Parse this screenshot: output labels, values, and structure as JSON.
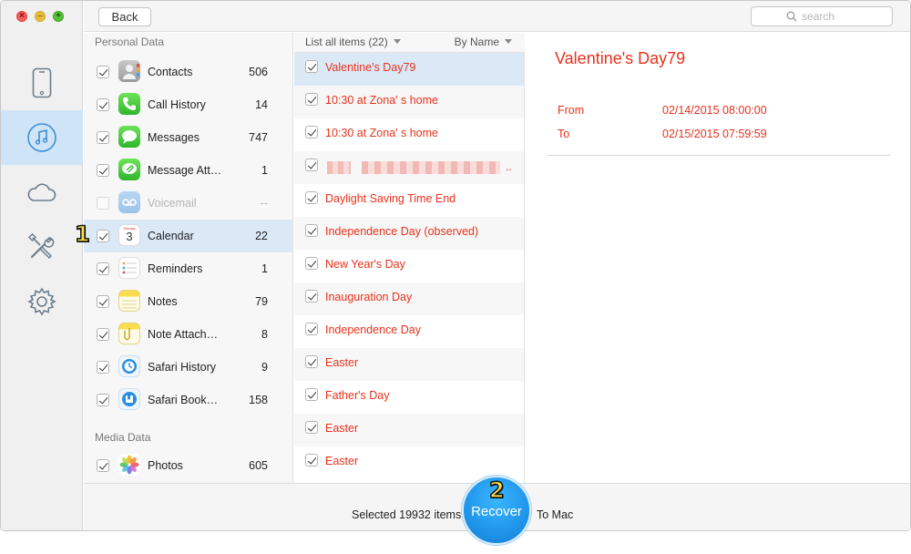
{
  "toolbar": {
    "back_label": "Back",
    "search_placeholder": "search"
  },
  "categories": {
    "personal_header": "Personal Data",
    "media_header": "Media Data",
    "items": [
      {
        "name": "Contacts",
        "count": "506",
        "checked": true,
        "icon": "contacts-icon"
      },
      {
        "name": "Call History",
        "count": "14",
        "checked": true,
        "icon": "phone-icon"
      },
      {
        "name": "Messages",
        "count": "747",
        "checked": true,
        "icon": "messages-icon"
      },
      {
        "name": "Message Att…",
        "count": "1",
        "checked": true,
        "icon": "message-attachment-icon"
      },
      {
        "name": "Voicemail",
        "count": "--",
        "checked": false,
        "icon": "voicemail-icon"
      },
      {
        "name": "Calendar",
        "count": "22",
        "checked": true,
        "icon": "calendar-icon"
      },
      {
        "name": "Reminders",
        "count": "1",
        "checked": true,
        "icon": "reminders-icon"
      },
      {
        "name": "Notes",
        "count": "79",
        "checked": true,
        "icon": "notes-icon"
      },
      {
        "name": "Note Attach…",
        "count": "8",
        "checked": true,
        "icon": "note-attachment-icon"
      },
      {
        "name": "Safari History",
        "count": "9",
        "checked": true,
        "icon": "safari-history-icon"
      },
      {
        "name": "Safari Book…",
        "count": "158",
        "checked": true,
        "icon": "safari-bookmark-icon"
      }
    ],
    "media_items": [
      {
        "name": "Photos",
        "count": "605",
        "checked": true,
        "icon": "photos-icon"
      }
    ],
    "calendar_day": "3",
    "calendar_weekday": "Sunday"
  },
  "item_list": {
    "header_left": "List all items (22)",
    "header_right": "By Name",
    "rows": [
      "Valentine's Day79",
      "10:30 at Zona' s home",
      "10:30 at Zona' s home",
      "",
      "Daylight Saving Time End",
      "Independence Day (observed)",
      "New Year's Day",
      "Inauguration Day",
      "Independence Day",
      "Easter",
      "Father's Day",
      "Easter",
      "Easter"
    ],
    "blurred_suffix": ".."
  },
  "detail": {
    "title": "Valentine's Day79",
    "from_label": "From",
    "from_value": "02/14/2015 08:00:00",
    "to_label": "To",
    "to_value": "02/15/2015 07:59:59"
  },
  "bottom": {
    "selected_text": "Selected 19932 items",
    "recover_label": "Recover",
    "to_mac_text": "To Mac"
  },
  "badges": {
    "step1": "1",
    "step2": "2"
  },
  "colors": {
    "accent_red": "#e8321c",
    "selection_blue": "#dbe9f7",
    "recover_blue": "#1b8fe6"
  }
}
